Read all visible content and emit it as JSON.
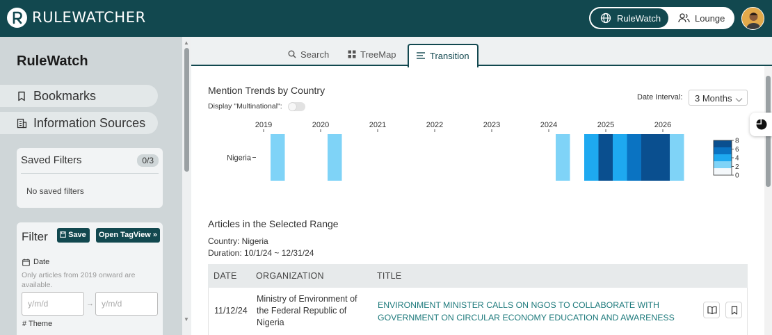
{
  "app": {
    "name": "RULEWATCHER"
  },
  "header": {
    "modes": [
      {
        "label": "RuleWatch",
        "icon": "globe-icon",
        "active": true
      },
      {
        "label": "Lounge",
        "icon": "users-icon",
        "active": false
      }
    ]
  },
  "sidebar": {
    "title": "RuleWatch",
    "nav": [
      {
        "label": "Bookmarks",
        "icon": "bookmark-icon"
      },
      {
        "label": "Information Sources",
        "icon": "building-icon"
      }
    ],
    "saved_filters": {
      "title": "Saved Filters",
      "count": "0/3",
      "empty_text": "No saved filters"
    },
    "filter": {
      "title": "Filter",
      "save_label": "Save",
      "tagview_label": "Open TagView",
      "date_label": "Date",
      "date_note": "Only articles from 2019 onward are available.",
      "date_from_placeholder": "y/m/d",
      "date_to_placeholder": "y/m/d",
      "next_section": "# Theme"
    }
  },
  "tabs": [
    {
      "label": "Search",
      "icon": "search-icon"
    },
    {
      "label": "TreeMap",
      "icon": "grid-icon"
    },
    {
      "label": "Transition",
      "icon": "list-icon",
      "active": true
    }
  ],
  "trends": {
    "title": "Mention Trends by Country",
    "multinational_label": "Display \"Multinational\":",
    "multinational_on": false,
    "interval_label": "Date Interval:",
    "interval_value": "3 Months"
  },
  "chart_data": {
    "type": "heatmap",
    "title": "Mention Trends by Country",
    "x_ticks": [
      "2019",
      "2020",
      "2021",
      "2022",
      "2023",
      "2024",
      "2025",
      "2026"
    ],
    "y": [
      "Nigeria"
    ],
    "interval": "3 Months",
    "cells": [
      {
        "period": "2019 Q1",
        "value": 1
      },
      {
        "period": "2020 Q1",
        "value": 1
      },
      {
        "period": "2024 Q1",
        "value": 1
      },
      {
        "period": "2024 Q3",
        "value": 3
      },
      {
        "period": "2024 Q4",
        "value": 7
      },
      {
        "period": "2025 Q1",
        "value": 3
      },
      {
        "period": "2025 Q2",
        "value": 5
      },
      {
        "period": "2025 Q3",
        "value": 7
      },
      {
        "period": "2025 Q4",
        "value": 8
      },
      {
        "period": "2026 Q1",
        "value": 1
      }
    ],
    "color_scale": {
      "min": 0,
      "max": 8,
      "ticks": [
        "8",
        "6",
        "4",
        "2",
        "0"
      ],
      "colors": [
        "#f4f8fb",
        "#7fd3f7",
        "#1ea9f0",
        "#0a73c2",
        "#0a4f8f"
      ]
    }
  },
  "articles": {
    "title": "Articles in the Selected Range",
    "country_line": "Country: Nigeria",
    "duration_line": "Duration: 10/1/24 ~ 12/31/24",
    "columns": [
      "DATE",
      "ORGANIZATION",
      "TITLE"
    ],
    "rows": [
      {
        "date": "11/12/24",
        "organization": "Ministry of Environment of the Federal Republic of Nigeria",
        "title": "ENVIRONMENT MINISTER CALLS ON NGOS TO COLLABORATE WITH GOVERNMENT ON CIRCULAR ECONOMY EDUCATION AND AWARENESS"
      }
    ]
  }
}
